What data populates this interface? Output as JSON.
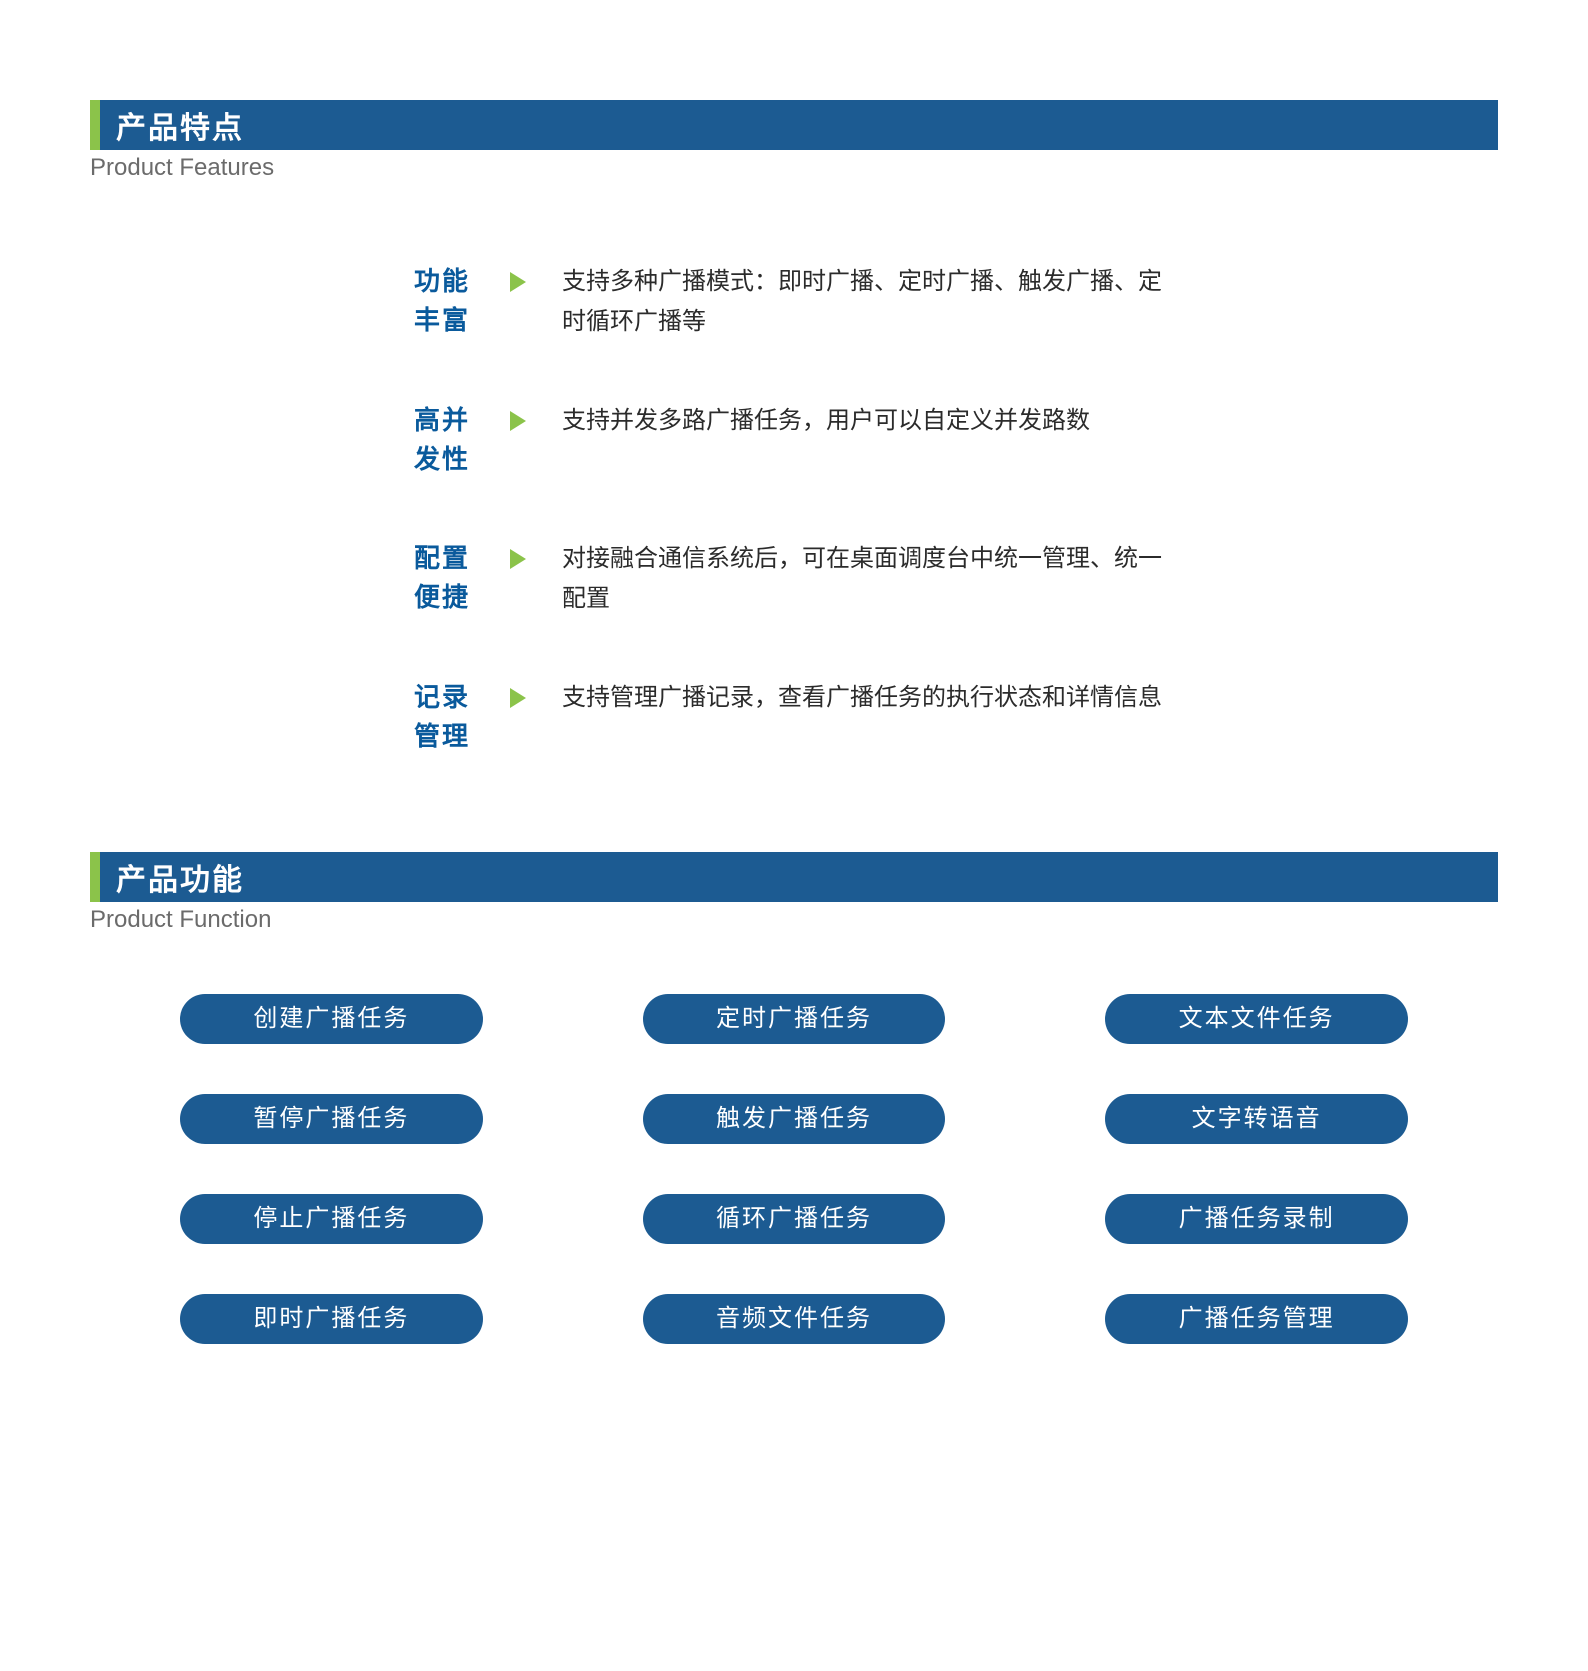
{
  "section_features": {
    "title_cn": "产品特点",
    "title_en": "Product Features",
    "items": [
      {
        "label": "功能丰富",
        "desc": "支持多种广播模式：即时广播、定时广播、触发广播、定时循环广播等"
      },
      {
        "label": "高并发性",
        "desc": "支持并发多路广播任务，用户可以自定义并发路数"
      },
      {
        "label": "配置便捷",
        "desc": "对接融合通信系统后，可在桌面调度台中统一管理、统一配置"
      },
      {
        "label": "记录管理",
        "desc": "支持管理广播记录，查看广播任务的执行状态和详情信息"
      }
    ]
  },
  "section_functions": {
    "title_cn": "产品功能",
    "title_en": "Product Function",
    "items": [
      "创建广播任务",
      "定时广播任务",
      "文本文件任务",
      "暂停广播任务",
      "触发广播任务",
      "文字转语音",
      "停止广播任务",
      "循环广播任务",
      "广播任务录制",
      "即时广播任务",
      "音频文件任务",
      "广播任务管理"
    ]
  }
}
